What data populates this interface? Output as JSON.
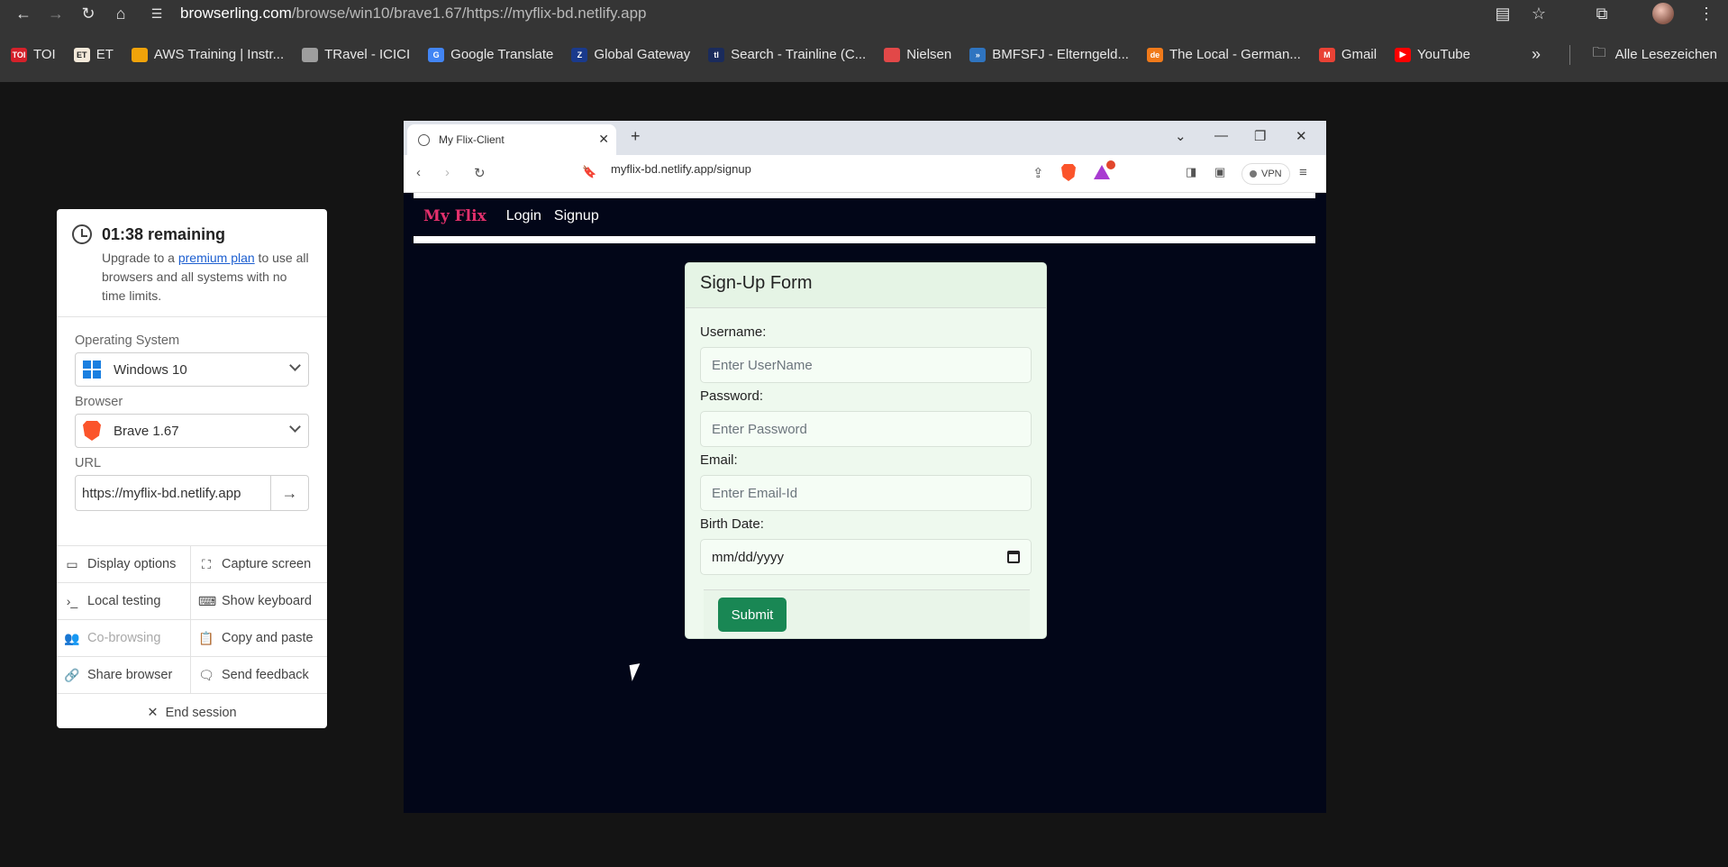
{
  "outer_browser": {
    "url_host": "browserling.com",
    "url_path": "/browse/win10/brave1.67/https://myflix-bd.netlify.app",
    "bookmarks": [
      {
        "label": "TOI",
        "icon": "toi-icon",
        "color": "#d4212a",
        "badge": "TOI"
      },
      {
        "label": "ET",
        "icon": "et-icon",
        "color": "#f3e9da",
        "badge": "ET"
      },
      {
        "label": "AWS Training | Instr...",
        "icon": "aws-icon",
        "color": "#f0a30a",
        "badge": ""
      },
      {
        "label": "TRavel - ICICI",
        "icon": "globe-icon",
        "color": "#9e9e9e",
        "badge": ""
      },
      {
        "label": "Google Translate",
        "icon": "translate-icon",
        "color": "#4285f4",
        "badge": "G"
      },
      {
        "label": "Global Gateway",
        "icon": "zeiss-icon",
        "color": "#1a3a8c",
        "badge": "Z"
      },
      {
        "label": "Search - Trainline (C...",
        "icon": "trainline-icon",
        "color": "#1a2b5c",
        "badge": "tl"
      },
      {
        "label": "Nielsen",
        "icon": "nielsen-icon",
        "color": "#e24848",
        "badge": ""
      },
      {
        "label": "BMFSFJ - Elterngeld...",
        "icon": "bmfsfj-icon",
        "color": "#2f74c0",
        "badge": "»"
      },
      {
        "label": "The Local - German...",
        "icon": "thelocal-icon",
        "color": "#f07a1a",
        "badge": "de"
      },
      {
        "label": "Gmail",
        "icon": "gmail-icon",
        "color": "#e94235",
        "badge": "M"
      },
      {
        "label": "YouTube",
        "icon": "youtube-icon",
        "color": "#ff0000",
        "badge": "▶"
      }
    ],
    "all_bookmarks_label": "Alle Lesezeichen"
  },
  "panel": {
    "timer_title": "01:38 remaining",
    "timer_text_before": "Upgrade to a ",
    "timer_link": "premium plan",
    "timer_text_after": " to use all browsers and all systems with no time limits.",
    "os_label": "Operating System",
    "os_value": "Windows 10",
    "browser_label": "Browser",
    "browser_value": "Brave 1.67",
    "url_label": "URL",
    "url_value": "https://myflix-bd.netlify.app",
    "actions": [
      {
        "label": "Display options",
        "icon": "monitor-icon",
        "glyph": "▭",
        "disabled": false
      },
      {
        "label": "Capture screen",
        "icon": "capture-icon",
        "glyph": "⛶",
        "disabled": false
      },
      {
        "label": "Local testing",
        "icon": "terminal-icon",
        "glyph": "›_",
        "disabled": false
      },
      {
        "label": "Show keyboard",
        "icon": "keyboard-icon",
        "glyph": "⌨",
        "disabled": false
      },
      {
        "label": "Co-browsing",
        "icon": "users-icon",
        "glyph": "👥",
        "disabled": true
      },
      {
        "label": "Copy and paste",
        "icon": "clipboard-icon",
        "glyph": "📋",
        "disabled": false
      },
      {
        "label": "Share browser",
        "icon": "link-icon",
        "glyph": "🔗",
        "disabled": false
      },
      {
        "label": "Send feedback",
        "icon": "feedback-icon",
        "glyph": "🗨",
        "disabled": false
      }
    ],
    "end_session": "End session"
  },
  "inner_browser": {
    "tab_title": "My Flix-Client",
    "url": "myflix-bd.netlify.app/signup",
    "vpn_label": "VPN"
  },
  "page": {
    "brand": "My Flix",
    "nav_login": "Login",
    "nav_signup": "Signup",
    "form_title": "Sign-Up Form",
    "username_label": "Username:",
    "username_placeholder": "Enter UserName",
    "password_label": "Password:",
    "password_placeholder": "Enter Password",
    "email_label": "Email:",
    "email_placeholder": "Enter Email-Id",
    "birth_label": "Birth Date:",
    "birth_value": "mm/dd/yyyy",
    "submit_label": "Submit"
  }
}
